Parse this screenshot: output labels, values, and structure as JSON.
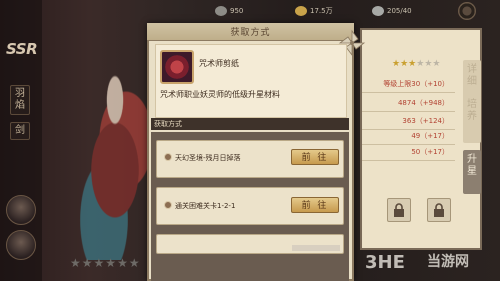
{
  "dialog": {
    "title": "获取方式",
    "item": {
      "name": "咒术师剪纸",
      "description": "咒术师职业妖灵师的低级升星材料"
    },
    "sources_header": "获取方式",
    "sources": [
      {
        "text": "天幻圣境-残月日掉落",
        "button": "前 往"
      },
      {
        "text": "通关困难关卡1-2-1",
        "button": "前 往"
      }
    ]
  },
  "top_bar": {
    "resources": [
      {
        "value": "950",
        "icon": "ingot-icon",
        "color": "#8d8c87"
      },
      {
        "value": "17.5万",
        "icon": "gold-coin-icon",
        "color": "#c9a34a"
      },
      {
        "value": "205/40",
        "icon": "stamina-icon",
        "color": "#a7a9a6"
      }
    ]
  },
  "left_panel": {
    "rarity": "SSR",
    "tab_1": "羽\n焰",
    "tab_2": "剑"
  },
  "right_panel": {
    "stats": [
      "等级上限30（+10）",
      "4874（+948）",
      "363（+124）",
      "49（+17）",
      "50（+17）"
    ],
    "tabs": [
      "详",
      "升星",
      "升星"
    ],
    "tab_labels": [
      "详\n细",
      "培\n养",
      "升\n星"
    ]
  },
  "watermark": {
    "text": "当游网",
    "logo": "3HE"
  }
}
